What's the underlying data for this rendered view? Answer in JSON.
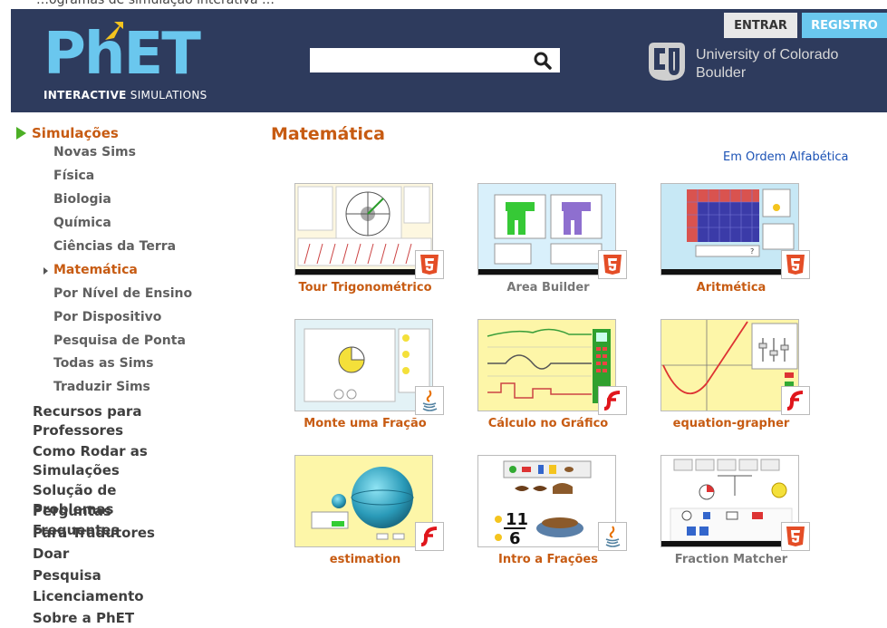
{
  "top_cut_text": "…ogramas de simulação interativa …",
  "header": {
    "logo_big": "PhET",
    "logo_sub_bold": "INTERACTIVE",
    "logo_sub_light": " SIMULATIONS",
    "search_placeholder": "",
    "login_label": "ENTRAR",
    "register_label": "REGISTRO",
    "university_line1": "University of Colorado",
    "university_line2": "Boulder"
  },
  "sidebar": {
    "head": "Simulações",
    "sub_items": [
      {
        "label": "Novas Sims"
      },
      {
        "label": "Física"
      },
      {
        "label": "Biologia"
      },
      {
        "label": "Química"
      },
      {
        "label": "Ciências da Terra"
      },
      {
        "label": "Matemática",
        "active": true
      },
      {
        "label": "Por Nível de Ensino"
      },
      {
        "label": "Por Dispositivo"
      },
      {
        "label": "Pesquisa de Ponta"
      },
      {
        "label": "Todas as Sims"
      },
      {
        "label": "Traduzir Sims"
      }
    ],
    "main_items": [
      {
        "label": "Recursos para Professores"
      },
      {
        "label": "Como Rodar as Simulações"
      },
      {
        "label": "Solução de Problemas"
      },
      {
        "label": "Perguntas Frequentes"
      },
      {
        "label": "Para Tradutores"
      },
      {
        "label": "Doar"
      },
      {
        "label": "Pesquisa"
      },
      {
        "label": "Licenciamento"
      },
      {
        "label": "Sobre a PhET"
      }
    ]
  },
  "main": {
    "title": "Matemática",
    "alpha_link": "Em Ordem Alfabética",
    "sims": [
      {
        "title": "Tour Trigonométrico",
        "badge": "html5",
        "caption_color": "orange"
      },
      {
        "title": "Area Builder",
        "badge": "html5",
        "caption_color": "gray"
      },
      {
        "title": "Aritmética",
        "badge": "html5",
        "caption_color": "orange"
      },
      {
        "title": "Monte uma Fração",
        "badge": "java",
        "caption_color": "orange"
      },
      {
        "title": "Cálculo no Gráfico",
        "badge": "flash",
        "caption_color": "orange"
      },
      {
        "title": "equation-grapher",
        "badge": "flash",
        "caption_color": "orange"
      },
      {
        "title": "estimation",
        "badge": "flash",
        "caption_color": "orange"
      },
      {
        "title": "Intro a Frações",
        "badge": "java",
        "caption_color": "orange"
      },
      {
        "title": "Fraction Matcher",
        "badge": "html5",
        "caption_color": "gray"
      }
    ],
    "thumb_text": {
      "arith_answer": "?",
      "fraction_num": "11",
      "fraction_den": "6"
    }
  },
  "colors": {
    "header_bg": "#2e3b5d",
    "accent_orange": "#c75b12",
    "link_blue": "#1b52b5",
    "phet_blue": "#6ac7ee",
    "sidebar_green": "#4caf25"
  }
}
